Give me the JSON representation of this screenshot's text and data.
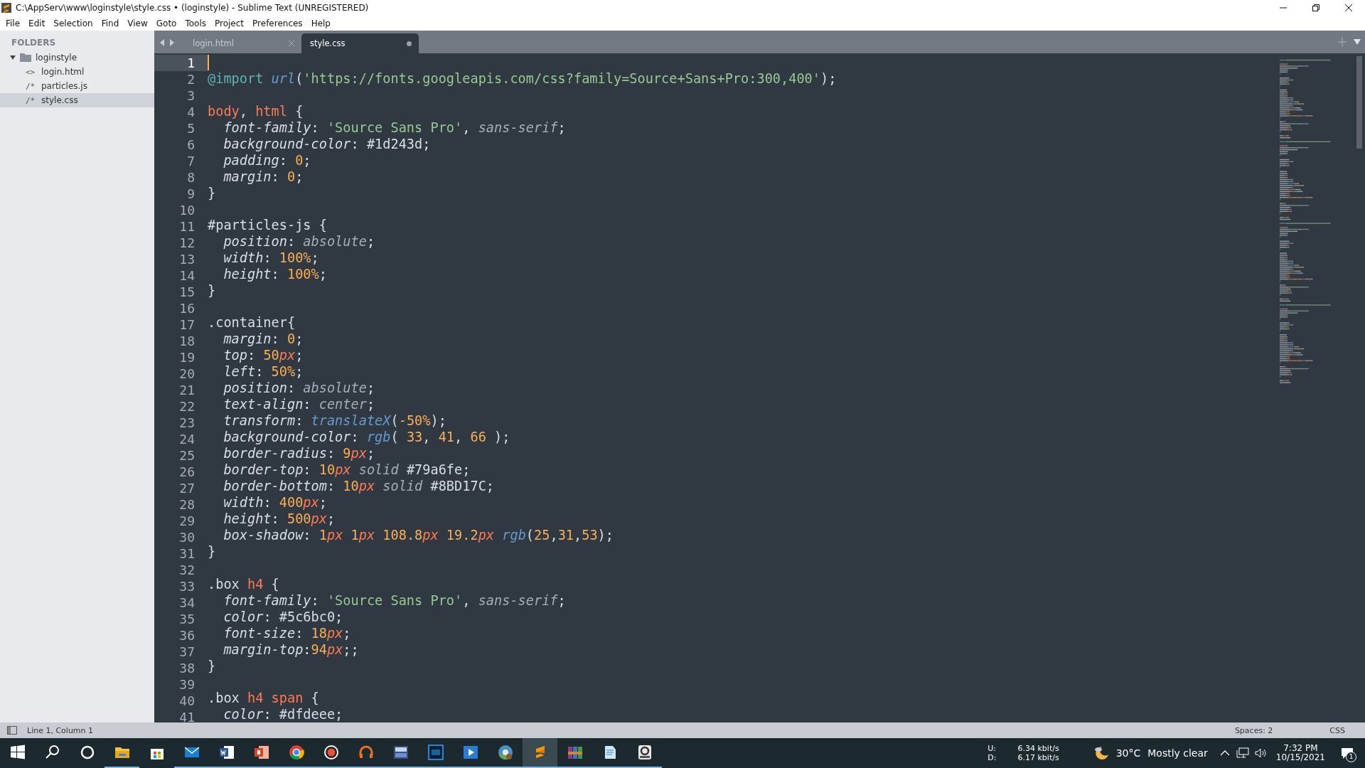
{
  "window": {
    "title": "C:\\AppServ\\www\\loginstyle\\style.css • (loginstyle) - Sublime Text (UNREGISTERED)"
  },
  "menu": [
    "File",
    "Edit",
    "Selection",
    "Find",
    "View",
    "Goto",
    "Tools",
    "Project",
    "Preferences",
    "Help"
  ],
  "sidebar": {
    "heading": "FOLDERS",
    "tree": [
      {
        "label": "loginstyle",
        "expanded": true,
        "selected": false,
        "children": [
          {
            "icon": "<>",
            "label": "login.html",
            "selected": false
          },
          {
            "icon": "/*",
            "label": "particles.js",
            "selected": false
          },
          {
            "icon": "/*",
            "label": "style.css",
            "selected": true
          }
        ]
      }
    ]
  },
  "tabs": [
    {
      "label": "login.html",
      "selected": false,
      "dirty": false
    },
    {
      "label": "style.css",
      "selected": true,
      "dirty": true
    }
  ],
  "editor": {
    "lines": [
      {
        "number": "1",
        "current": true
      },
      {
        "number": "2",
        "tokens": [
          {
            "kind": "at",
            "text": "@import "
          },
          {
            "kind": "fn",
            "text": "url"
          },
          {
            "kind": "plain",
            "text": "("
          },
          {
            "kind": "str",
            "text": "'https://fonts.googleapis.com/css?family=Source+Sans+Pro:300,400'"
          },
          {
            "kind": "plain",
            "text": ");"
          }
        ]
      },
      {
        "number": "3"
      },
      {
        "number": "4",
        "tokens": [
          {
            "kind": "tag",
            "text": "body"
          },
          {
            "kind": "plain",
            "text": ", "
          },
          {
            "kind": "tag",
            "text": "html"
          },
          {
            "kind": "plain",
            "text": " {"
          }
        ]
      },
      {
        "number": "5",
        "tokens": [
          {
            "kind": "prop",
            "text": "  font-family"
          },
          {
            "kind": "plain",
            "text": ": "
          },
          {
            "kind": "str",
            "text": "'Source Sans Pro'"
          },
          {
            "kind": "plain",
            "text": ", "
          },
          {
            "kind": "kw",
            "text": "sans-serif"
          },
          {
            "kind": "plain",
            "text": ";"
          }
        ]
      },
      {
        "number": "6",
        "tokens": [
          {
            "kind": "prop",
            "text": "  background-color"
          },
          {
            "kind": "plain",
            "text": ": #1d243d;"
          }
        ]
      },
      {
        "number": "7",
        "tokens": [
          {
            "kind": "prop",
            "text": "  padding"
          },
          {
            "kind": "plain",
            "text": ": "
          },
          {
            "kind": "num",
            "text": "0"
          },
          {
            "kind": "plain",
            "text": ";"
          }
        ]
      },
      {
        "number": "8",
        "tokens": [
          {
            "kind": "prop",
            "text": "  margin"
          },
          {
            "kind": "plain",
            "text": ": "
          },
          {
            "kind": "num",
            "text": "0"
          },
          {
            "kind": "plain",
            "text": ";"
          }
        ]
      },
      {
        "number": "9",
        "tokens": [
          {
            "kind": "plain",
            "text": "}"
          }
        ]
      },
      {
        "number": "10"
      },
      {
        "number": "11",
        "tokens": [
          {
            "kind": "sel",
            "text": "#particles-js"
          },
          {
            "kind": "plain",
            "text": " {"
          }
        ]
      },
      {
        "number": "12",
        "tokens": [
          {
            "kind": "prop",
            "text": "  position"
          },
          {
            "kind": "plain",
            "text": ": "
          },
          {
            "kind": "kw",
            "text": "absolute"
          },
          {
            "kind": "plain",
            "text": ";"
          }
        ]
      },
      {
        "number": "13",
        "tokens": [
          {
            "kind": "prop",
            "text": "  width"
          },
          {
            "kind": "plain",
            "text": ": "
          },
          {
            "kind": "num",
            "text": "100%"
          },
          {
            "kind": "plain",
            "text": ";"
          }
        ]
      },
      {
        "number": "14",
        "tokens": [
          {
            "kind": "prop",
            "text": "  height"
          },
          {
            "kind": "plain",
            "text": ": "
          },
          {
            "kind": "num",
            "text": "100%"
          },
          {
            "kind": "plain",
            "text": ";"
          }
        ]
      },
      {
        "number": "15",
        "tokens": [
          {
            "kind": "plain",
            "text": "}"
          }
        ]
      },
      {
        "number": "16"
      },
      {
        "number": "17",
        "tokens": [
          {
            "kind": "sel",
            "text": ".container"
          },
          {
            "kind": "plain",
            "text": "{"
          }
        ]
      },
      {
        "number": "18",
        "tokens": [
          {
            "kind": "prop",
            "text": "  margin"
          },
          {
            "kind": "plain",
            "text": ": "
          },
          {
            "kind": "num",
            "text": "0"
          },
          {
            "kind": "plain",
            "text": ";"
          }
        ]
      },
      {
        "number": "19",
        "tokens": [
          {
            "kind": "prop",
            "text": "  top"
          },
          {
            "kind": "plain",
            "text": ": "
          },
          {
            "kind": "num",
            "text": "50"
          },
          {
            "kind": "unit",
            "text": "px"
          },
          {
            "kind": "plain",
            "text": ";"
          }
        ]
      },
      {
        "number": "20",
        "tokens": [
          {
            "kind": "prop",
            "text": "  left"
          },
          {
            "kind": "plain",
            "text": ": "
          },
          {
            "kind": "num",
            "text": "50%"
          },
          {
            "kind": "plain",
            "text": ";"
          }
        ]
      },
      {
        "number": "21",
        "tokens": [
          {
            "kind": "prop",
            "text": "  position"
          },
          {
            "kind": "plain",
            "text": ": "
          },
          {
            "kind": "kw",
            "text": "absolute"
          },
          {
            "kind": "plain",
            "text": ";"
          }
        ]
      },
      {
        "number": "22",
        "tokens": [
          {
            "kind": "prop",
            "text": "  text-align"
          },
          {
            "kind": "plain",
            "text": ": "
          },
          {
            "kind": "kw",
            "text": "center"
          },
          {
            "kind": "plain",
            "text": ";"
          }
        ]
      },
      {
        "number": "23",
        "tokens": [
          {
            "kind": "prop",
            "text": "  transform"
          },
          {
            "kind": "plain",
            "text": ": "
          },
          {
            "kind": "fn",
            "text": "translateX"
          },
          {
            "kind": "plain",
            "text": "("
          },
          {
            "kind": "num",
            "text": "-50%"
          },
          {
            "kind": "plain",
            "text": ");"
          }
        ]
      },
      {
        "number": "24",
        "tokens": [
          {
            "kind": "prop",
            "text": "  background-color"
          },
          {
            "kind": "plain",
            "text": ": "
          },
          {
            "kind": "fn",
            "text": "rgb"
          },
          {
            "kind": "plain",
            "text": "( "
          },
          {
            "kind": "num",
            "text": "33"
          },
          {
            "kind": "plain",
            "text": ", "
          },
          {
            "kind": "num",
            "text": "41"
          },
          {
            "kind": "plain",
            "text": ", "
          },
          {
            "kind": "num",
            "text": "66"
          },
          {
            "kind": "plain",
            "text": " );"
          }
        ]
      },
      {
        "number": "25",
        "tokens": [
          {
            "kind": "prop",
            "text": "  border-radius"
          },
          {
            "kind": "plain",
            "text": ": "
          },
          {
            "kind": "num",
            "text": "9"
          },
          {
            "kind": "unit",
            "text": "px"
          },
          {
            "kind": "plain",
            "text": ";"
          }
        ]
      },
      {
        "number": "26",
        "tokens": [
          {
            "kind": "prop",
            "text": "  border-top"
          },
          {
            "kind": "plain",
            "text": ": "
          },
          {
            "kind": "num",
            "text": "10"
          },
          {
            "kind": "unit",
            "text": "px"
          },
          {
            "kind": "kw",
            "text": " solid"
          },
          {
            "kind": "plain",
            "text": " #79a6fe;"
          }
        ]
      },
      {
        "number": "27",
        "tokens": [
          {
            "kind": "prop",
            "text": "  border-bottom"
          },
          {
            "kind": "plain",
            "text": ": "
          },
          {
            "kind": "num",
            "text": "10"
          },
          {
            "kind": "unit",
            "text": "px"
          },
          {
            "kind": "kw",
            "text": " solid"
          },
          {
            "kind": "plain",
            "text": " #8BD17C;"
          }
        ]
      },
      {
        "number": "28",
        "tokens": [
          {
            "kind": "prop",
            "text": "  width"
          },
          {
            "kind": "plain",
            "text": ": "
          },
          {
            "kind": "num",
            "text": "400"
          },
          {
            "kind": "unit",
            "text": "px"
          },
          {
            "kind": "plain",
            "text": ";"
          }
        ]
      },
      {
        "number": "29",
        "tokens": [
          {
            "kind": "prop",
            "text": "  height"
          },
          {
            "kind": "plain",
            "text": ": "
          },
          {
            "kind": "num",
            "text": "500"
          },
          {
            "kind": "unit",
            "text": "px"
          },
          {
            "kind": "plain",
            "text": ";"
          }
        ]
      },
      {
        "number": "30",
        "tokens": [
          {
            "kind": "prop",
            "text": "  box-shadow"
          },
          {
            "kind": "plain",
            "text": ": "
          },
          {
            "kind": "num",
            "text": "1"
          },
          {
            "kind": "unit",
            "text": "px"
          },
          {
            "kind": "num",
            "text": " 1"
          },
          {
            "kind": "unit",
            "text": "px"
          },
          {
            "kind": "num",
            "text": " 108.8"
          },
          {
            "kind": "unit",
            "text": "px"
          },
          {
            "kind": "num",
            "text": " 19.2"
          },
          {
            "kind": "unit",
            "text": "px"
          },
          {
            "kind": "fn",
            "text": " rgb"
          },
          {
            "kind": "plain",
            "text": "("
          },
          {
            "kind": "num",
            "text": "25"
          },
          {
            "kind": "plain",
            "text": ","
          },
          {
            "kind": "num",
            "text": "31"
          },
          {
            "kind": "plain",
            "text": ","
          },
          {
            "kind": "num",
            "text": "53"
          },
          {
            "kind": "plain",
            "text": ");"
          }
        ]
      },
      {
        "number": "31",
        "tokens": [
          {
            "kind": "plain",
            "text": "}"
          }
        ]
      },
      {
        "number": "32"
      },
      {
        "number": "33",
        "tokens": [
          {
            "kind": "sel",
            "text": ".box "
          },
          {
            "kind": "tag",
            "text": "h4"
          },
          {
            "kind": "plain",
            "text": " {"
          }
        ]
      },
      {
        "number": "34",
        "tokens": [
          {
            "kind": "prop",
            "text": "  font-family"
          },
          {
            "kind": "plain",
            "text": ": "
          },
          {
            "kind": "str",
            "text": "'Source Sans Pro'"
          },
          {
            "kind": "plain",
            "text": ", "
          },
          {
            "kind": "kw",
            "text": "sans-serif"
          },
          {
            "kind": "plain",
            "text": ";"
          }
        ]
      },
      {
        "number": "35",
        "tokens": [
          {
            "kind": "prop",
            "text": "  color"
          },
          {
            "kind": "plain",
            "text": ": #5c6bc0;"
          }
        ]
      },
      {
        "number": "36",
        "tokens": [
          {
            "kind": "prop",
            "text": "  font-size"
          },
          {
            "kind": "plain",
            "text": ": "
          },
          {
            "kind": "num",
            "text": "18"
          },
          {
            "kind": "unit",
            "text": "px"
          },
          {
            "kind": "plain",
            "text": ";"
          }
        ]
      },
      {
        "number": "37",
        "tokens": [
          {
            "kind": "prop",
            "text": "  margin-top"
          },
          {
            "kind": "plain",
            "text": ":"
          },
          {
            "kind": "num",
            "text": "94"
          },
          {
            "kind": "unit",
            "text": "px"
          },
          {
            "kind": "plain",
            "text": ";;"
          }
        ]
      },
      {
        "number": "38",
        "tokens": [
          {
            "kind": "plain",
            "text": "}"
          }
        ]
      },
      {
        "number": "39"
      },
      {
        "number": "40",
        "tokens": [
          {
            "kind": "sel",
            "text": ".box "
          },
          {
            "kind": "tag",
            "text": "h4"
          },
          {
            "kind": "tag",
            "text": " span"
          },
          {
            "kind": "plain",
            "text": " {"
          }
        ]
      },
      {
        "number": "41",
        "tokens": [
          {
            "kind": "prop",
            "text": "  color"
          },
          {
            "kind": "plain",
            "text": ": #dfdeee;"
          }
        ]
      }
    ]
  },
  "status_bar": {
    "position": "Line 1, Column 1",
    "indentation": "Spaces: 2",
    "syntax": "CSS"
  },
  "taskbar": {
    "apps": [
      {
        "kind": "start",
        "running": false,
        "selected": false
      },
      {
        "kind": "search",
        "running": false,
        "selected": false
      },
      {
        "kind": "cortana",
        "running": false,
        "selected": false
      },
      {
        "kind": "folder",
        "running": true,
        "selected": false
      },
      {
        "kind": "store",
        "running": false,
        "selected": false
      },
      {
        "kind": "mail",
        "running": true,
        "selected": false
      },
      {
        "kind": "doc",
        "running": true,
        "selected": false
      },
      {
        "kind": "slides",
        "running": true,
        "selected": false
      },
      {
        "kind": "browser",
        "running": true,
        "selected": false
      },
      {
        "kind": "record",
        "running": true,
        "selected": false
      },
      {
        "kind": "headset",
        "running": true,
        "selected": false
      },
      {
        "kind": "dev",
        "running": true,
        "selected": false
      },
      {
        "kind": "image",
        "running": true,
        "selected": false
      },
      {
        "kind": "media",
        "running": true,
        "selected": false
      },
      {
        "kind": "browser2",
        "running": true,
        "selected": false
      },
      {
        "kind": "editor",
        "running": true,
        "selected": true
      },
      {
        "kind": "archive",
        "running": true,
        "selected": false
      },
      {
        "kind": "notepad",
        "running": true,
        "selected": false
      },
      {
        "kind": "pdf",
        "running": true,
        "selected": false
      }
    ],
    "net_up_label": "U:",
    "net_up": "6.34 kbit/s",
    "net_down_label": "D:",
    "net_down": "6.17 kbit/s",
    "temperature": "30°C",
    "weather": "Mostly clear",
    "time": "7:32 PM",
    "date": "10/15/2021",
    "notifications": "1"
  }
}
